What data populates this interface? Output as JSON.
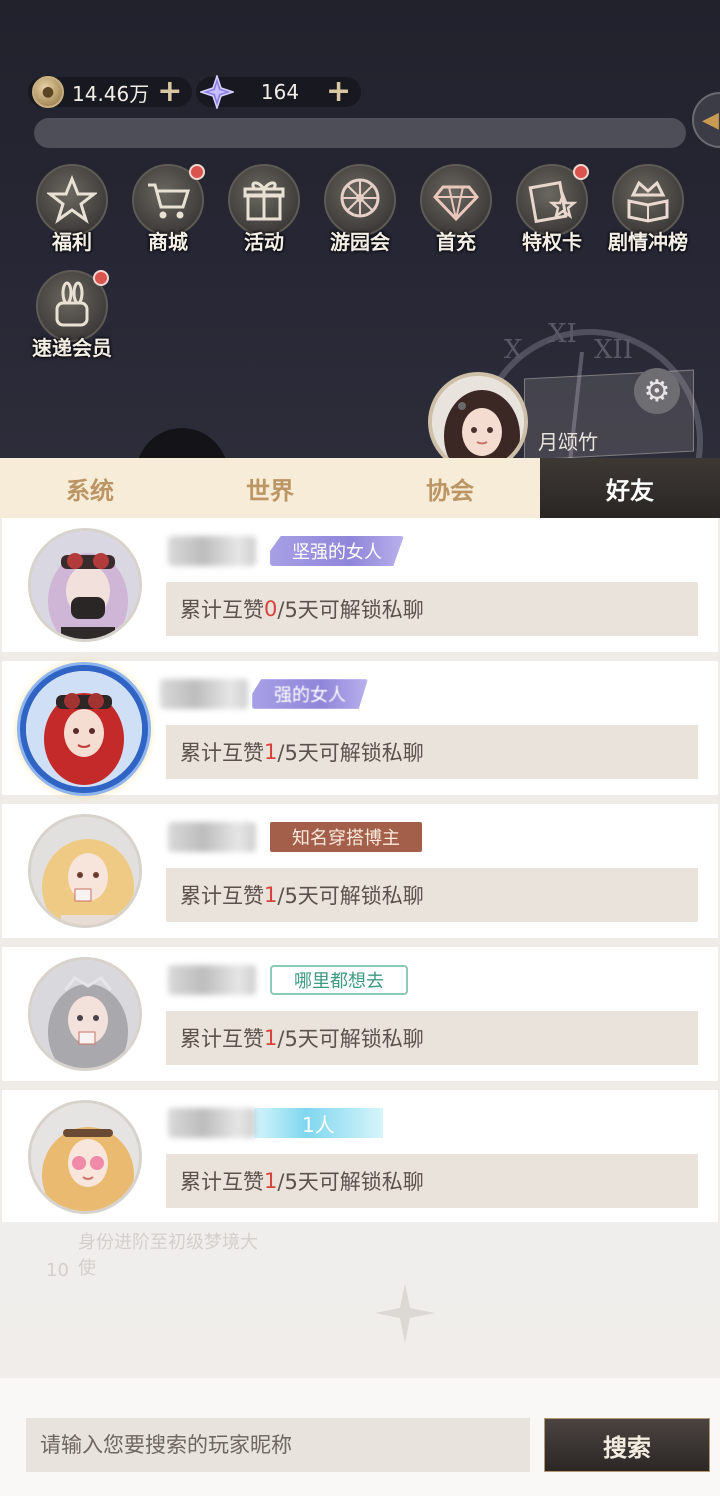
{
  "currency": {
    "coins": "14.46万",
    "gems": "164"
  },
  "menu": [
    {
      "label": "福利",
      "icon": "star-icon",
      "dot": false
    },
    {
      "label": "商城",
      "icon": "cart-icon",
      "dot": true
    },
    {
      "label": "活动",
      "icon": "gift-icon",
      "dot": false
    },
    {
      "label": "游园会",
      "icon": "ferris-wheel-icon",
      "dot": false
    },
    {
      "label": "首充",
      "icon": "diamond-icon",
      "dot": false
    },
    {
      "label": "特权卡",
      "icon": "card-icon",
      "dot": true
    },
    {
      "label": "剧情冲榜",
      "icon": "crown-book-icon",
      "dot": false
    },
    {
      "label": "速递会员",
      "icon": "bunny-icon",
      "dot": true
    }
  ],
  "player": {
    "name": "月颂竹"
  },
  "tabs": [
    {
      "label": "系统"
    },
    {
      "label": "世界"
    },
    {
      "label": "协会"
    },
    {
      "label": "好友",
      "active": true
    }
  ],
  "friends": [
    {
      "title": "坚强的女人",
      "prefix": "累计互赞",
      "count": "0",
      "suffix": "/5天可解锁私聊"
    },
    {
      "title": "强的女人",
      "prefix": "累计互赞",
      "count": "1",
      "suffix": "/5天可解锁私聊"
    },
    {
      "title": "知名穿搭博主",
      "prefix": "累计互赞",
      "count": "1",
      "suffix": "/5天可解锁私聊"
    },
    {
      "title": "哪里都想去",
      "prefix": "累计互赞",
      "count": "1",
      "suffix": "/5天可解锁私聊"
    },
    {
      "title": "1人",
      "prefix": "累计互赞",
      "count": "1",
      "suffix": "/5天可解锁私聊"
    }
  ],
  "background_text": {
    "quest": "身份进阶至初级梦境大使",
    "quest_count": "10"
  },
  "search": {
    "placeholder": "请输入您要搜索的玩家昵称",
    "button": "搜索"
  },
  "colors": {
    "accent_red": "#d9423b",
    "tab_active_bg": "#2f2a27",
    "tab_text": "#bc9565"
  }
}
